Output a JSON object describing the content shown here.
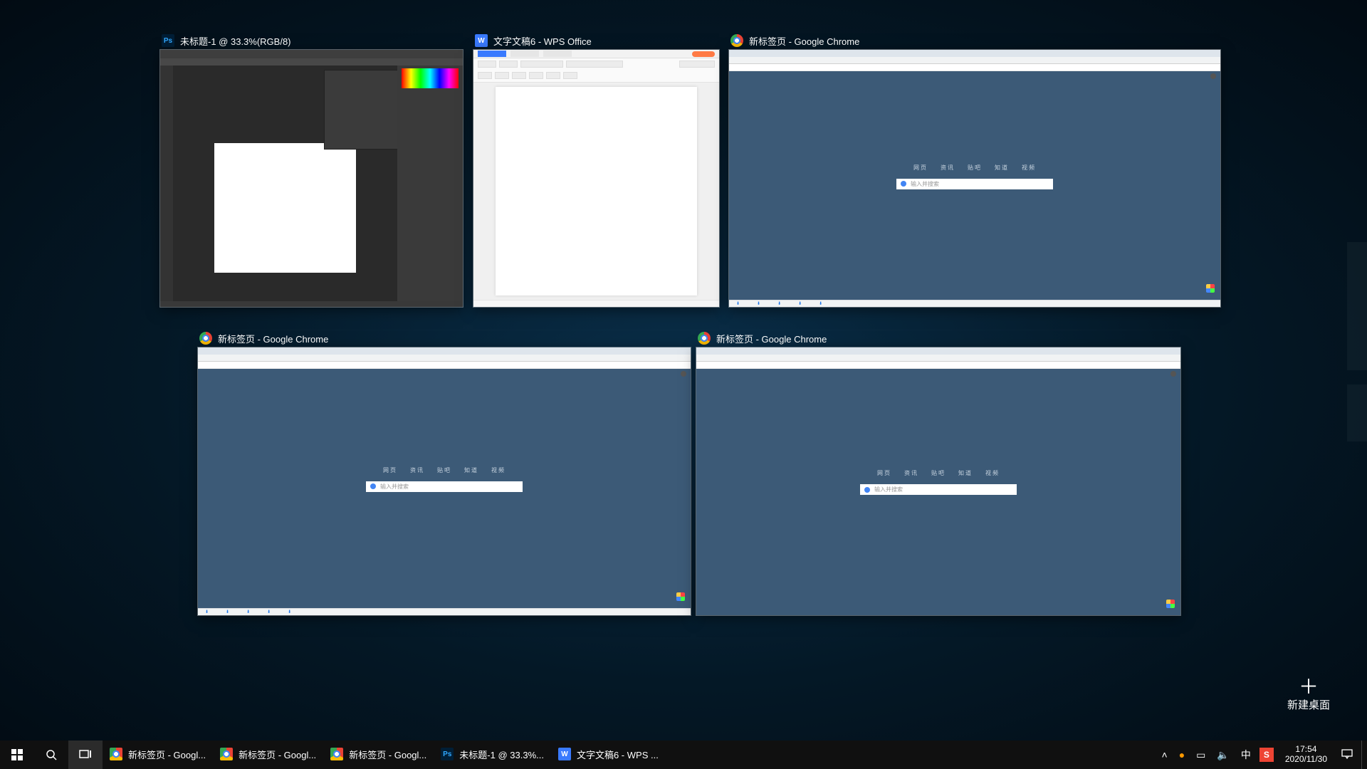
{
  "thumbnails": [
    {
      "id": "t1",
      "title": "未标题-1 @ 33.3%(RGB/8)",
      "app": "photoshop"
    },
    {
      "id": "t2",
      "title": "文字文稿6 - WPS Office",
      "app": "wps"
    },
    {
      "id": "t3",
      "title": "新标签页 - Google Chrome",
      "app": "chrome"
    },
    {
      "id": "t4",
      "title": "新标签页 - Google Chrome",
      "app": "chrome"
    },
    {
      "id": "t5",
      "title": "新标签页 - Google Chrome",
      "app": "chrome"
    }
  ],
  "chrome_newtab": {
    "nav": [
      "网页",
      "资讯",
      "贴吧",
      "知道",
      "视频"
    ],
    "placeholder": "输入并搜索"
  },
  "new_desktop_label": "新建桌面",
  "taskbar": {
    "apps": [
      {
        "icon": "chrome",
        "label": "新标签页 - Googl..."
      },
      {
        "icon": "chrome",
        "label": "新标签页 - Googl..."
      },
      {
        "icon": "chrome",
        "label": "新标签页 - Googl..."
      },
      {
        "icon": "ps",
        "label": "未标题-1 @ 33.3%..."
      },
      {
        "icon": "wps",
        "label": "文字文稿6 - WPS ..."
      }
    ],
    "ime": "中",
    "sogou": "S",
    "clock_time": "17:54",
    "clock_date": "2020/11/30"
  }
}
